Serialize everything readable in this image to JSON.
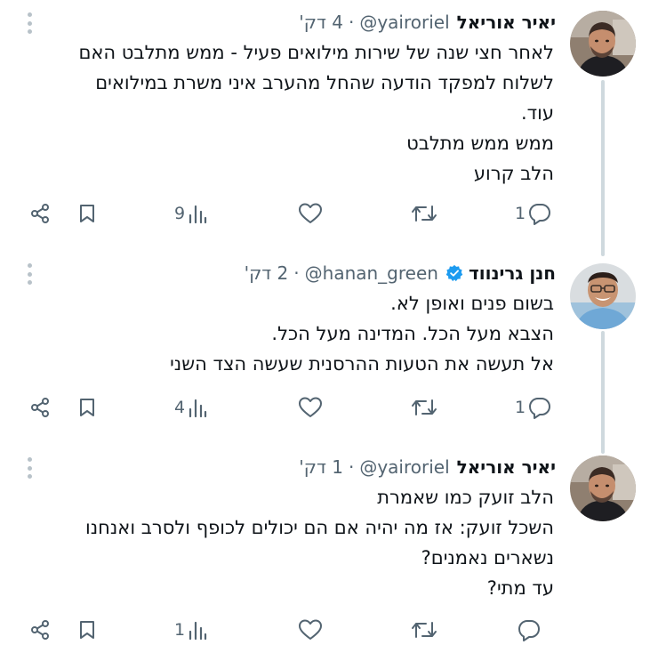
{
  "tweets": [
    {
      "name": "יאיר אוריאל",
      "handle": "@yairoriel",
      "time": "4 דק'",
      "verified": false,
      "lines": [
        "לאחר חצי שנה של שירות מילואים פעיל - ממש מתלבט האם",
        "לשלוח למפקד הודעה שהחל מהערב איני משרת במילואים",
        "עוד.",
        "ממש ממש מתלבט",
        "הלב קרוע"
      ],
      "views": "9",
      "replies": "1"
    },
    {
      "name": "חנן גרינווד",
      "handle": "@hanan_green",
      "time": "2 דק'",
      "verified": true,
      "lines": [
        "בשום פנים ואופן לא.",
        "הצבא מעל הכל. המדינה מעל הכל.",
        "אל תעשה את הטעות ההרסנית שעשה הצד השני"
      ],
      "views": "4",
      "replies": "1"
    },
    {
      "name": "יאיר אוריאל",
      "handle": "@yairoriel",
      "time": "1 דק'",
      "verified": false,
      "lines": [
        "הלב זועק כמו שאמרת",
        "השכל זועק: אז מה יהיה אם הם יכולים לכופף ולסרב ואנחנו",
        "נשארים נאמנים?",
        "עד מתי?"
      ],
      "views": "1",
      "replies": ""
    }
  ],
  "separator": "·",
  "colors": {
    "text": "#0f1419",
    "secondary": "#536471",
    "verified": "#1d9bf0",
    "thread_line": "#cfd9de"
  },
  "icons": {
    "share": "share-icon",
    "bookmark": "bookmark-icon",
    "views": "views-icon",
    "like": "heart-icon",
    "retweet": "retweet-icon",
    "reply": "reply-icon",
    "more": "more-vertical-icon",
    "verified": "verified-badge-icon"
  }
}
